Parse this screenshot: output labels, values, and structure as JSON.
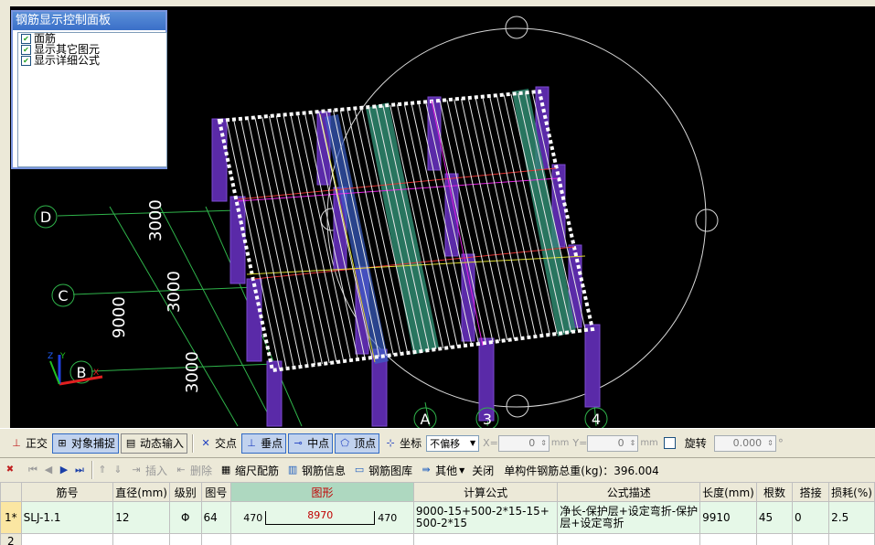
{
  "colors": {
    "viewport_bg": "#000000",
    "slab_grid": "#ffffff",
    "column": "#5a2aa8",
    "beam": "#3aaa80",
    "axis_grid": "#2fb34a",
    "active_header": "#aed8c0",
    "selected_row": "#e6f8e8"
  },
  "panel": {
    "title": "钢筋显示控制面板",
    "options": [
      {
        "label": "面筋",
        "checked": true
      },
      {
        "label": "显示其它图元",
        "checked": true
      },
      {
        "label": "显示详细公式",
        "checked": true
      }
    ]
  },
  "viewport": {
    "axis_labels": [
      "D",
      "C",
      "B",
      "A",
      "3",
      "4"
    ],
    "dimensions": [
      "3000",
      "3000",
      "3000",
      "9000"
    ],
    "axis_triad": {
      "x": "X",
      "y": "Y",
      "z": "Z"
    }
  },
  "toolbar1": {
    "orthogonal": "正交",
    "object_snap": "对象捕捉",
    "dynamic_input": "动态输入",
    "intersection": "交点",
    "perpendicular": "垂点",
    "midpoint": "中点",
    "vertex": "顶点",
    "coordinates": "坐标",
    "offset_mode": "不偏移",
    "x_label": "X=",
    "x_value": "0",
    "y_label": "Y=",
    "y_value": "0",
    "unit": "mm",
    "rotate_label": "旋转",
    "rotate_value": "0.000",
    "degree": "°"
  },
  "toolbar2": {
    "insert": "插入",
    "delete": "删除",
    "scale_rebar": "缩尺配筋",
    "rebar_info": "钢筋信息",
    "rebar_library": "钢筋图库",
    "other": "其他",
    "close": "关闭",
    "total_weight": "单构件钢筋总重(kg)：396.004"
  },
  "table": {
    "headers": [
      "筋号",
      "直径(mm)",
      "级别",
      "图号",
      "图形",
      "计算公式",
      "公式描述",
      "长度(mm)",
      "根数",
      "搭接",
      "损耗(%)"
    ],
    "rows": [
      {
        "row_no": "1*",
        "name": "SLJ-1.1",
        "diameter": "12",
        "grade": "Φ",
        "figure_no": "64",
        "shape_left": "470",
        "shape_mid": "8970",
        "shape_right": "470",
        "formula": "9000-15+500-2*15-15+500-2*15",
        "description": "净长-保护层+设定弯折-保护层+设定弯折",
        "length": "9910",
        "count": "45",
        "lap": "0",
        "loss": "2.5"
      },
      {
        "row_no": "2"
      }
    ]
  }
}
